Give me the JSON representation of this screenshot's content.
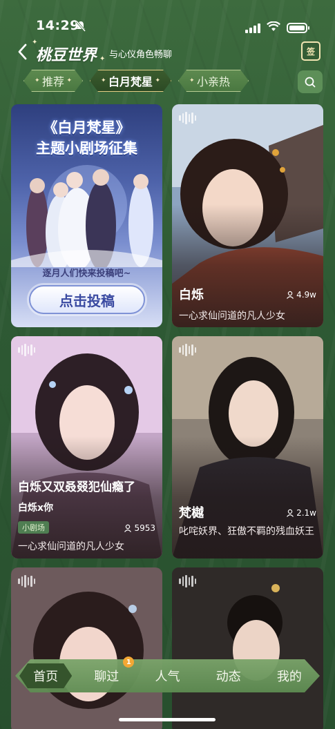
{
  "status_bar": {
    "time": "14:29"
  },
  "header": {
    "title": "桃豆世界",
    "subtitle": "与心仪角色畅聊",
    "checkin_label": "签"
  },
  "tabs": [
    {
      "label": "推荐",
      "active": false
    },
    {
      "label": "白月梵星",
      "active": true
    },
    {
      "label": "小亲热",
      "active": false
    }
  ],
  "promo": {
    "title_line1": "《白月梵星》",
    "title_line2": "主题小剧场征集",
    "tagline": "逐月人们快来投稿吧~",
    "cta": "点击投稿"
  },
  "cards": [
    {
      "name": "白烁",
      "count": "4.9w",
      "description": "一心求仙问道的凡人少女"
    },
    {
      "story_title": "白烁又双叒叕犯仙瘾了",
      "story_sub": "白烁x你",
      "badge": "小剧场",
      "count": "5953",
      "description": "一心求仙问道的凡人少女"
    },
    {
      "name": "梵樾",
      "count": "2.1w",
      "description": "叱咤妖界、狂傲不羁的残血妖王"
    }
  ],
  "bottom_nav": {
    "items": [
      {
        "label": "首页",
        "active": true
      },
      {
        "label": "聊过",
        "active": false,
        "badge": "1"
      },
      {
        "label": "人气",
        "active": false
      },
      {
        "label": "动态",
        "active": false
      },
      {
        "label": "我的",
        "active": false
      }
    ]
  },
  "colors": {
    "accent_green": "#3b5c2e",
    "badge_orange": "#f3a734",
    "promo_blue": "#3a4aa1"
  }
}
